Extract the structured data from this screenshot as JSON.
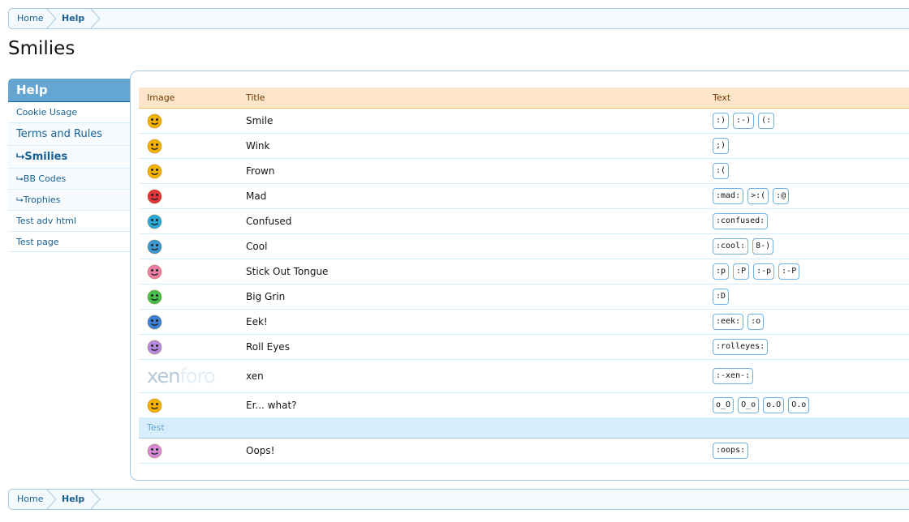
{
  "breadcrumb": {
    "home": "Home",
    "help": "Help"
  },
  "page_title": "Smilies",
  "sidebar": {
    "heading": "Help",
    "items": [
      {
        "label": "Cookie Usage"
      },
      {
        "label": "Terms and Rules"
      },
      {
        "label": "⮡Smilies"
      },
      {
        "label": "⮡BB Codes"
      },
      {
        "label": "⮡Trophies"
      },
      {
        "label": "Test adv html"
      },
      {
        "label": "Test page"
      }
    ]
  },
  "table": {
    "headers": {
      "image": "Image",
      "title": "Title",
      "text": "Text"
    },
    "rows": [
      {
        "title": "Smile",
        "codes": [
          ":)",
          ":-)",
          "(:"
        ],
        "color": "#f5b000",
        "icon": "smile-icon"
      },
      {
        "title": "Wink",
        "codes": [
          ";)"
        ],
        "color": "#f5b000",
        "icon": "wink-icon"
      },
      {
        "title": "Frown",
        "codes": [
          ":("
        ],
        "color": "#f5b000",
        "icon": "frown-icon"
      },
      {
        "title": "Mad",
        "codes": [
          ":mad:",
          ">:(",
          ":@"
        ],
        "color": "#e2323a",
        "icon": "mad-icon"
      },
      {
        "title": "Confused",
        "codes": [
          ":confused:"
        ],
        "color": "#27a8d8",
        "icon": "confused-icon"
      },
      {
        "title": "Cool",
        "codes": [
          ":cool:",
          "8-)"
        ],
        "color": "#3a9ad8",
        "icon": "cool-icon"
      },
      {
        "title": "Stick Out Tongue",
        "codes": [
          ":p",
          ":P",
          ":-p",
          ":-P"
        ],
        "color": "#f07ca8",
        "icon": "tongue-icon"
      },
      {
        "title": "Big Grin",
        "codes": [
          ":D"
        ],
        "color": "#46c04a",
        "icon": "grin-icon"
      },
      {
        "title": "Eek!",
        "codes": [
          ":eek:",
          ":o"
        ],
        "color": "#3c7fd8",
        "icon": "eek-icon"
      },
      {
        "title": "Roll Eyes",
        "codes": [
          ":rolleyes:"
        ],
        "color": "#b58ae0",
        "icon": "rolleyes-icon"
      },
      {
        "title": "xen",
        "codes": [
          ":-xen-:"
        ],
        "logo_a": "xen",
        "logo_b": "foro"
      },
      {
        "title": "Er... what?",
        "codes": [
          "o_O",
          "O_o",
          "o.O",
          "O.o"
        ],
        "color": "#f5b000",
        "icon": "er-what-icon"
      }
    ],
    "group": "Test",
    "group_rows": [
      {
        "title": "Oops!",
        "codes": [
          ":oops:"
        ],
        "color": "#d88ad8",
        "icon": "oops-icon"
      }
    ]
  }
}
